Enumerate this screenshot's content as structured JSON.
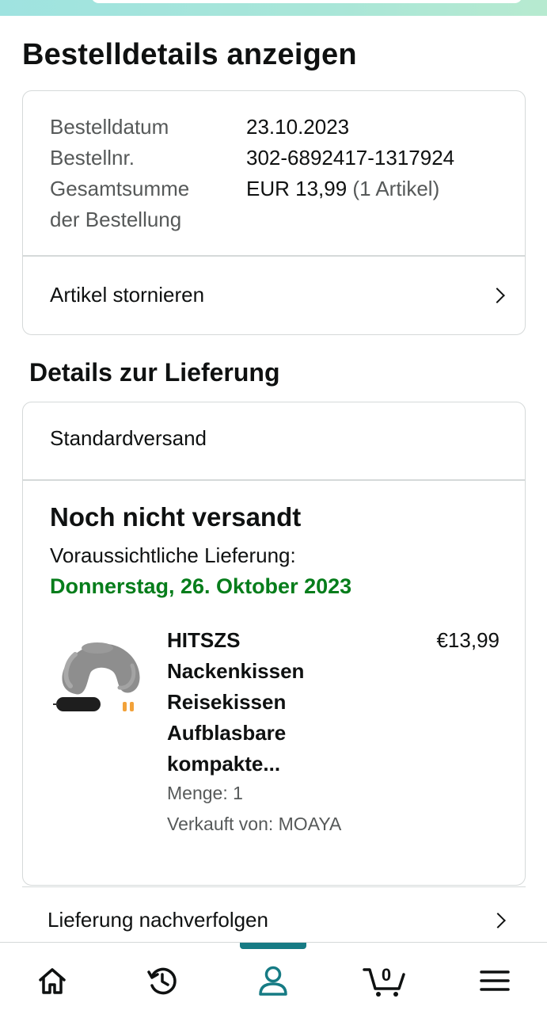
{
  "page": {
    "title": "Bestelldetails anzeigen"
  },
  "summary": {
    "order_date_label": "Bestelldatum",
    "order_date_value": "23.10.2023",
    "order_number_label": "Bestellnr.",
    "order_number_value": "302-6892417-1317924",
    "total_label_line1": "Gesamtsumme",
    "total_label_line2": "der Bestellung",
    "total_value": "EUR 13,99",
    "total_items": "(1 Artikel)",
    "cancel_label": "Artikel stornieren"
  },
  "delivery": {
    "section_title": "Details zur Lieferung",
    "shipping_method": "Standardversand",
    "status": "Noch nicht versandt",
    "estimated_label": "Voraussichtliche Lieferung:",
    "estimated_date": "Donnerstag, 26. Oktober 2023",
    "product": {
      "name_lines": [
        "HITSZS",
        "Nackenkissen",
        "Reisekissen",
        "Aufblasbare",
        "kompakte..."
      ],
      "price": "€13,99",
      "quantity": "Menge: 1",
      "seller": "Verkauft von: MOAYA"
    },
    "track_label": "Lieferung nachverfolgen"
  },
  "bottom_nav": {
    "cart_count": "0",
    "active": "account",
    "items": [
      {
        "icon": "home-icon"
      },
      {
        "icon": "history-icon"
      },
      {
        "icon": "account-icon"
      },
      {
        "icon": "cart-icon"
      },
      {
        "icon": "menu-icon"
      }
    ]
  },
  "colors": {
    "accent": "#167b84",
    "delivery_green": "#067d1b",
    "border": "#d5d9d9",
    "muted_text": "#565959"
  }
}
